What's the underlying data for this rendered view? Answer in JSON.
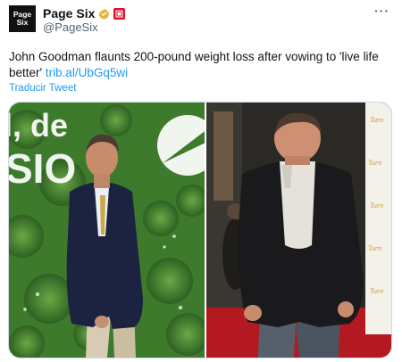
{
  "account": {
    "avatar_line1": "Page",
    "avatar_line2": "Six",
    "display_name": "Page Six",
    "handle": "@PageSix",
    "verified_badge": "gold-verified-check",
    "affiliate_color": "#e0102a"
  },
  "menu": {
    "more_label": "···"
  },
  "tweet": {
    "text": "John Goodman flaunts 200-pound weight loss after vowing to 'live life better' ",
    "link_text": "trib.al/UbGq5wi",
    "translate_label": "Traducir Tweet"
  },
  "media": {
    "left_image": {
      "description": "before-after-left",
      "backdrop_text": "l, de\nSIO"
    },
    "right_image": {
      "description": "before-after-right",
      "backdrop_text": "Turn Project"
    }
  },
  "colors": {
    "link": "#1d9bf0",
    "secondary_text": "#536471",
    "verified_gold": "#e8b339"
  }
}
